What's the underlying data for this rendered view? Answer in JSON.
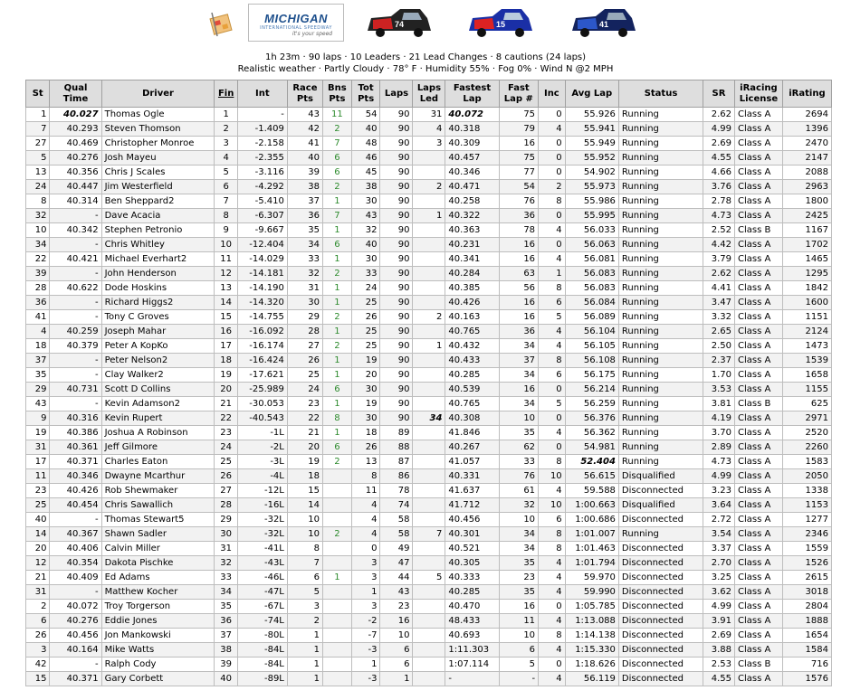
{
  "summary": {
    "line1": "1h 23m · 90 laps · 10 Leaders · 21 Lead Changes · 8 cautions (24 laps)",
    "line2": "Realistic weather · Partly Cloudy · 78° F · Humidity 55% · Fog 0% · Wind N @2 MPH"
  },
  "logo": {
    "main": "MICHIGAN",
    "sub": "INTERNATIONAL SPEEDWAY",
    "tag": "it's your speed"
  },
  "truck_numbers": [
    "74",
    "15",
    "41"
  ],
  "columns": [
    "St",
    "Qual Time",
    "Driver",
    "Fin",
    "Int",
    "Race Pts",
    "Bns Pts",
    "Tot Pts",
    "Laps",
    "Laps Led",
    "Fastest Lap",
    "Fast Lap #",
    "Inc",
    "Avg Lap",
    "Status",
    "SR",
    "iRacing License",
    "iRating"
  ],
  "rows": [
    [
      "1",
      "40.027",
      "Thomas Ogle",
      "1",
      "-",
      "43",
      "11",
      "54",
      "90",
      "31",
      "40.072",
      "75",
      "0",
      "55.926",
      "Running",
      "2.62",
      "Class A",
      "2694"
    ],
    [
      "7",
      "40.293",
      "Steven Thomson",
      "2",
      "-1.409",
      "42",
      "2",
      "40",
      "90",
      "4",
      "40.318",
      "79",
      "4",
      "55.941",
      "Running",
      "4.99",
      "Class A",
      "1396"
    ],
    [
      "27",
      "40.469",
      "Christopher Monroe",
      "3",
      "-2.158",
      "41",
      "7",
      "48",
      "90",
      "3",
      "40.309",
      "16",
      "0",
      "55.949",
      "Running",
      "2.69",
      "Class A",
      "2470"
    ],
    [
      "5",
      "40.276",
      "Josh Mayeu",
      "4",
      "-2.355",
      "40",
      "6",
      "46",
      "90",
      "",
      "40.457",
      "75",
      "0",
      "55.952",
      "Running",
      "4.55",
      "Class A",
      "2147"
    ],
    [
      "13",
      "40.356",
      "Chris J Scales",
      "5",
      "-3.116",
      "39",
      "6",
      "45",
      "90",
      "",
      "40.346",
      "77",
      "0",
      "54.902",
      "Running",
      "4.66",
      "Class A",
      "2088"
    ],
    [
      "24",
      "40.447",
      "Jim Westerfield",
      "6",
      "-4.292",
      "38",
      "2",
      "38",
      "90",
      "2",
      "40.471",
      "54",
      "2",
      "55.973",
      "Running",
      "3.76",
      "Class A",
      "2963"
    ],
    [
      "8",
      "40.314",
      "Ben Sheppard2",
      "7",
      "-5.410",
      "37",
      "1",
      "30",
      "90",
      "",
      "40.258",
      "76",
      "8",
      "55.986",
      "Running",
      "2.78",
      "Class A",
      "1800"
    ],
    [
      "32",
      "-",
      "Dave Acacia",
      "8",
      "-6.307",
      "36",
      "7",
      "43",
      "90",
      "1",
      "40.322",
      "36",
      "0",
      "55.995",
      "Running",
      "4.73",
      "Class A",
      "2425"
    ],
    [
      "10",
      "40.342",
      "Stephen Petronio",
      "9",
      "-9.667",
      "35",
      "1",
      "32",
      "90",
      "",
      "40.363",
      "78",
      "4",
      "56.033",
      "Running",
      "2.52",
      "Class B",
      "1167"
    ],
    [
      "34",
      "-",
      "Chris Whitley",
      "10",
      "-12.404",
      "34",
      "6",
      "40",
      "90",
      "",
      "40.231",
      "16",
      "0",
      "56.063",
      "Running",
      "4.42",
      "Class A",
      "1702"
    ],
    [
      "22",
      "40.421",
      "Michael Everhart2",
      "11",
      "-14.029",
      "33",
      "1",
      "30",
      "90",
      "",
      "40.341",
      "16",
      "4",
      "56.081",
      "Running",
      "3.79",
      "Class A",
      "1465"
    ],
    [
      "39",
      "-",
      "John Henderson",
      "12",
      "-14.181",
      "32",
      "2",
      "33",
      "90",
      "",
      "40.284",
      "63",
      "1",
      "56.083",
      "Running",
      "2.62",
      "Class A",
      "1295"
    ],
    [
      "28",
      "40.622",
      "Dode Hoskins",
      "13",
      "-14.190",
      "31",
      "1",
      "24",
      "90",
      "",
      "40.385",
      "56",
      "8",
      "56.083",
      "Running",
      "4.41",
      "Class A",
      "1842"
    ],
    [
      "36",
      "-",
      "Richard Higgs2",
      "14",
      "-14.320",
      "30",
      "1",
      "25",
      "90",
      "",
      "40.426",
      "16",
      "6",
      "56.084",
      "Running",
      "3.47",
      "Class A",
      "1600"
    ],
    [
      "41",
      "-",
      "Tony C Groves",
      "15",
      "-14.755",
      "29",
      "2",
      "26",
      "90",
      "2",
      "40.163",
      "16",
      "5",
      "56.089",
      "Running",
      "3.32",
      "Class A",
      "1151"
    ],
    [
      "4",
      "40.259",
      "Joseph Mahar",
      "16",
      "-16.092",
      "28",
      "1",
      "25",
      "90",
      "",
      "40.765",
      "36",
      "4",
      "56.104",
      "Running",
      "2.65",
      "Class A",
      "2124"
    ],
    [
      "18",
      "40.379",
      "Peter A KopKo",
      "17",
      "-16.174",
      "27",
      "2",
      "25",
      "90",
      "1",
      "40.432",
      "34",
      "4",
      "56.105",
      "Running",
      "2.50",
      "Class A",
      "1473"
    ],
    [
      "37",
      "-",
      "Peter Nelson2",
      "18",
      "-16.424",
      "26",
      "1",
      "19",
      "90",
      "",
      "40.433",
      "37",
      "8",
      "56.108",
      "Running",
      "2.37",
      "Class A",
      "1539"
    ],
    [
      "35",
      "-",
      "Clay Walker2",
      "19",
      "-17.621",
      "25",
      "1",
      "20",
      "90",
      "",
      "40.285",
      "34",
      "6",
      "56.175",
      "Running",
      "1.70",
      "Class A",
      "1658"
    ],
    [
      "29",
      "40.731",
      "Scott D Collins",
      "20",
      "-25.989",
      "24",
      "6",
      "30",
      "90",
      "",
      "40.539",
      "16",
      "0",
      "56.214",
      "Running",
      "3.53",
      "Class A",
      "1155"
    ],
    [
      "43",
      "-",
      "Kevin Adamson2",
      "21",
      "-30.053",
      "23",
      "1",
      "19",
      "90",
      "",
      "40.765",
      "34",
      "5",
      "56.259",
      "Running",
      "3.81",
      "Class B",
      "625"
    ],
    [
      "9",
      "40.316",
      "Kevin Rupert",
      "22",
      "-40.543",
      "22",
      "8",
      "30",
      "90",
      "34",
      "40.308",
      "10",
      "0",
      "56.376",
      "Running",
      "4.19",
      "Class A",
      "2971"
    ],
    [
      "19",
      "40.386",
      "Joshua A Robinson",
      "23",
      "-1L",
      "21",
      "1",
      "18",
      "89",
      "",
      "41.846",
      "35",
      "4",
      "56.362",
      "Running",
      "3.70",
      "Class A",
      "2520"
    ],
    [
      "31",
      "40.361",
      "Jeff Gilmore",
      "24",
      "-2L",
      "20",
      "6",
      "26",
      "88",
      "",
      "40.267",
      "62",
      "0",
      "54.981",
      "Running",
      "2.89",
      "Class A",
      "2260"
    ],
    [
      "17",
      "40.371",
      "Charles Eaton",
      "25",
      "-3L",
      "19",
      "2",
      "13",
      "87",
      "",
      "41.057",
      "33",
      "8",
      "52.404",
      "Running",
      "4.73",
      "Class A",
      "1583"
    ],
    [
      "11",
      "40.346",
      "Dwayne Mcarthur",
      "26",
      "-4L",
      "18",
      "",
      "8",
      "86",
      "",
      "40.331",
      "76",
      "10",
      "56.615",
      "Disqualified",
      "4.99",
      "Class A",
      "2050"
    ],
    [
      "23",
      "40.426",
      "Rob Shewmaker",
      "27",
      "-12L",
      "15",
      "",
      "11",
      "78",
      "",
      "41.637",
      "61",
      "4",
      "59.588",
      "Disconnected",
      "3.23",
      "Class A",
      "1338"
    ],
    [
      "25",
      "40.454",
      "Chris Sawallich",
      "28",
      "-16L",
      "14",
      "",
      "4",
      "74",
      "",
      "41.712",
      "32",
      "10",
      "1:00.663",
      "Disqualified",
      "3.64",
      "Class A",
      "1153"
    ],
    [
      "40",
      "-",
      "Thomas Stewart5",
      "29",
      "-32L",
      "10",
      "",
      "4",
      "58",
      "",
      "40.456",
      "10",
      "6",
      "1:00.686",
      "Disconnected",
      "2.72",
      "Class A",
      "1277"
    ],
    [
      "14",
      "40.367",
      "Shawn Sadler",
      "30",
      "-32L",
      "10",
      "2",
      "4",
      "58",
      "7",
      "40.301",
      "34",
      "8",
      "1:01.007",
      "Running",
      "3.54",
      "Class A",
      "2346"
    ],
    [
      "20",
      "40.406",
      "Calvin Miller",
      "31",
      "-41L",
      "8",
      "",
      "0",
      "49",
      "",
      "40.521",
      "34",
      "8",
      "1:01.463",
      "Disconnected",
      "3.37",
      "Class A",
      "1559"
    ],
    [
      "12",
      "40.354",
      "Dakota Pischke",
      "32",
      "-43L",
      "7",
      "",
      "3",
      "47",
      "",
      "40.305",
      "35",
      "4",
      "1:01.794",
      "Disconnected",
      "2.70",
      "Class A",
      "1526"
    ],
    [
      "21",
      "40.409",
      "Ed Adams",
      "33",
      "-46L",
      "6",
      "1",
      "3",
      "44",
      "5",
      "40.333",
      "23",
      "4",
      "59.970",
      "Disconnected",
      "3.25",
      "Class A",
      "2615"
    ],
    [
      "31",
      "-",
      "Matthew Kocher",
      "34",
      "-47L",
      "5",
      "",
      "1",
      "43",
      "",
      "40.285",
      "35",
      "4",
      "59.990",
      "Disconnected",
      "3.62",
      "Class A",
      "3018"
    ],
    [
      "2",
      "40.072",
      "Troy Torgerson",
      "35",
      "-67L",
      "3",
      "",
      "3",
      "23",
      "",
      "40.470",
      "16",
      "0",
      "1:05.785",
      "Disconnected",
      "4.99",
      "Class A",
      "2804"
    ],
    [
      "6",
      "40.276",
      "Eddie Jones",
      "36",
      "-74L",
      "2",
      "",
      "-2",
      "16",
      "",
      "48.433",
      "11",
      "4",
      "1:13.088",
      "Disconnected",
      "3.91",
      "Class A",
      "1888"
    ],
    [
      "26",
      "40.456",
      "Jon Mankowski",
      "37",
      "-80L",
      "1",
      "",
      "-7",
      "10",
      "",
      "40.693",
      "10",
      "8",
      "1:14.138",
      "Disconnected",
      "2.69",
      "Class A",
      "1654"
    ],
    [
      "3",
      "40.164",
      "Mike Watts",
      "38",
      "-84L",
      "1",
      "",
      "-3",
      "6",
      "",
      "1:11.303",
      "6",
      "4",
      "1:15.330",
      "Disconnected",
      "3.88",
      "Class A",
      "1584"
    ],
    [
      "42",
      "-",
      "Ralph Cody",
      "39",
      "-84L",
      "1",
      "",
      "1",
      "6",
      "",
      "1:07.114",
      "5",
      "0",
      "1:18.626",
      "Disconnected",
      "2.53",
      "Class B",
      "716"
    ],
    [
      "15",
      "40.371",
      "Gary Corbett",
      "40",
      "-89L",
      "1",
      "",
      "-3",
      "1",
      "",
      "-",
      "-",
      "4",
      "56.119",
      "Disconnected",
      "4.55",
      "Class A",
      "1576"
    ]
  ]
}
